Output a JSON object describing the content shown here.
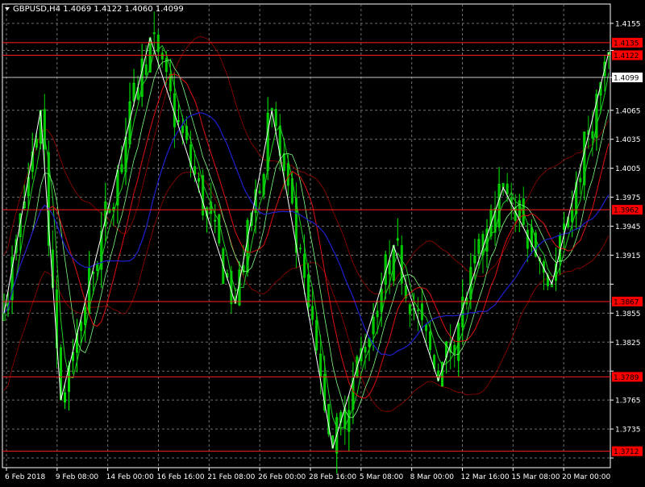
{
  "window": {
    "header": "GBPUSD,H4  1.4069 1.4122 1.4060 1.4099"
  },
  "colors": {
    "background": "#000000",
    "grid": "#6f6f6f",
    "bull_candle": "#00ff00",
    "bear_candle": "#00cc00",
    "ma_blue": "#2020d0",
    "ma_red": "#e01010",
    "ma_green": "#22cc22",
    "envelope": "#990000",
    "zigzag": "#ffffff",
    "level_line": "#ff2020",
    "price_line": "#c8c8c8",
    "axis_text": "#ffffff",
    "level_label_bg": "#ff0000"
  },
  "chart_data": {
    "type": "candlestick",
    "symbol": "GBPUSD",
    "timeframe": "H4",
    "last_ohlc": {
      "open": 1.4069,
      "high": 1.4122,
      "low": 1.406,
      "close": 1.4099
    },
    "ylim": [
      1.3695,
      1.4175
    ],
    "y_ticks": [
      1.4155,
      1.4127,
      1.4099,
      1.4065,
      1.4035,
      1.4005,
      1.3975,
      1.3945,
      1.3915,
      1.3885,
      1.3855,
      1.3825,
      1.3795,
      1.3765,
      1.3735,
      1.3705
    ],
    "y_tick_labels": [
      "1.4155",
      "",
      "",
      "1.4065",
      "1.4035",
      "1.4005",
      "1.3975",
      "1.3945",
      "1.3915",
      "",
      "1.3855",
      "1.3825",
      "1.3795",
      "1.3765",
      "1.3735",
      "1.3705"
    ],
    "x_labels": [
      "6 Feb 2018",
      "9 Feb 08:00",
      "14 Feb 00:00",
      "16 Feb 16:00",
      "21 Feb 08:00",
      "26 Feb 00:00",
      "28 Feb 16:00",
      "5 Mar 08:00",
      "8 Mar 00:00",
      "12 Mar 16:00",
      "15 Mar 08:00",
      "20 Mar 00:00"
    ],
    "horizontal_levels": [
      {
        "price": 1.4135,
        "label": "1.4135"
      },
      {
        "price": 1.4122,
        "label": "1.4122"
      },
      {
        "price": 1.3962,
        "label": "1.3962"
      },
      {
        "price": 1.3867,
        "label": "1.3867"
      },
      {
        "price": 1.3789,
        "label": "1.3789"
      },
      {
        "price": 1.3712,
        "label": "1.3712"
      }
    ],
    "current_price": {
      "price": 1.4099,
      "label": "1.4099"
    },
    "zigzag": [
      [
        0,
        1.3855
      ],
      [
        9,
        1.4065
      ],
      [
        14,
        1.3765
      ],
      [
        36,
        1.414
      ],
      [
        57,
        1.3865
      ],
      [
        66,
        1.4065
      ],
      [
        81,
        1.3715
      ],
      [
        96,
        1.3925
      ],
      [
        107,
        1.3785
      ],
      [
        123,
        1.3985
      ],
      [
        135,
        1.3885
      ],
      [
        149,
        1.4125
      ]
    ],
    "series_count": 150
  }
}
